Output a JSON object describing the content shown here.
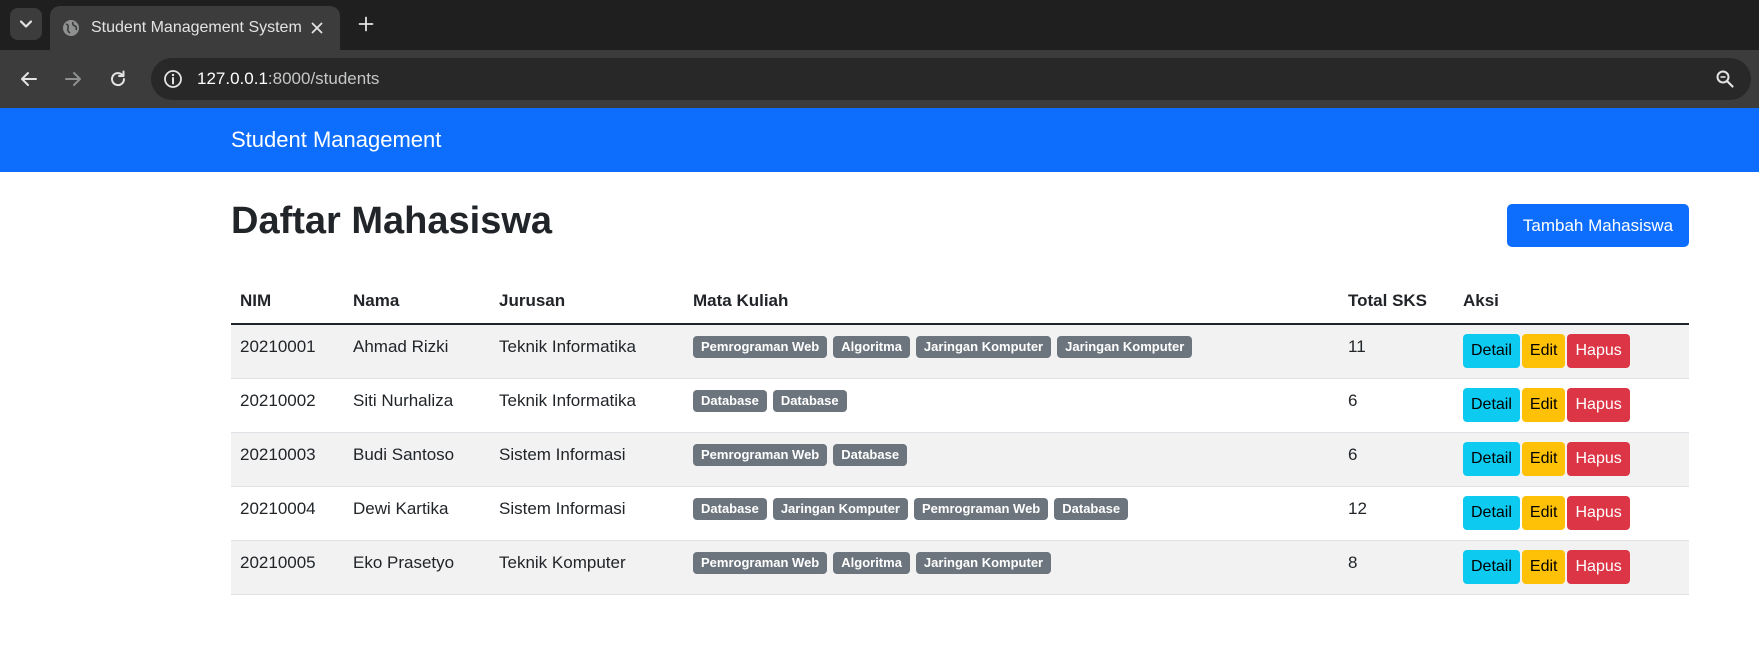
{
  "browser": {
    "tab_title": "Student Management System",
    "url_host": "127.0.0.1",
    "url_path": ":8000/students"
  },
  "navbar": {
    "brand": "Student Management"
  },
  "header": {
    "title": "Daftar Mahasiswa",
    "add_button": "Tambah Mahasiswa"
  },
  "table": {
    "columns": [
      "NIM",
      "Nama",
      "Jurusan",
      "Mata Kuliah",
      "Total SKS",
      "Aksi"
    ],
    "actions": {
      "detail": "Detail",
      "edit": "Edit",
      "delete": "Hapus"
    },
    "rows": [
      {
        "nim": "20210001",
        "nama": "Ahmad Rizki",
        "jurusan": "Teknik Informatika",
        "mata_kuliah": [
          "Pemrograman Web",
          "Algoritma",
          "Jaringan Komputer",
          "Jaringan Komputer"
        ],
        "total_sks": "11"
      },
      {
        "nim": "20210002",
        "nama": "Siti Nurhaliza",
        "jurusan": "Teknik Informatika",
        "mata_kuliah": [
          "Database",
          "Database"
        ],
        "total_sks": "6"
      },
      {
        "nim": "20210003",
        "nama": "Budi Santoso",
        "jurusan": "Sistem Informasi",
        "mata_kuliah": [
          "Pemrograman Web",
          "Database"
        ],
        "total_sks": "6"
      },
      {
        "nim": "20210004",
        "nama": "Dewi Kartika",
        "jurusan": "Sistem Informasi",
        "mata_kuliah": [
          "Database",
          "Jaringan Komputer",
          "Pemrograman Web",
          "Database"
        ],
        "total_sks": "12"
      },
      {
        "nim": "20210005",
        "nama": "Eko Prasetyo",
        "jurusan": "Teknik Komputer",
        "mata_kuliah": [
          "Pemrograman Web",
          "Algoritma",
          "Jaringan Komputer"
        ],
        "total_sks": "8"
      }
    ]
  },
  "colors": {
    "primary": "#0d6efd",
    "info": "#0dcaf0",
    "warning": "#ffc107",
    "danger": "#dc3545",
    "badge": "#6c757d"
  },
  "icons": [
    "tab-search-icon",
    "globe-icon",
    "close-icon",
    "plus-icon",
    "back-icon",
    "forward-icon",
    "reload-icon",
    "info-icon",
    "zoom-icon"
  ]
}
